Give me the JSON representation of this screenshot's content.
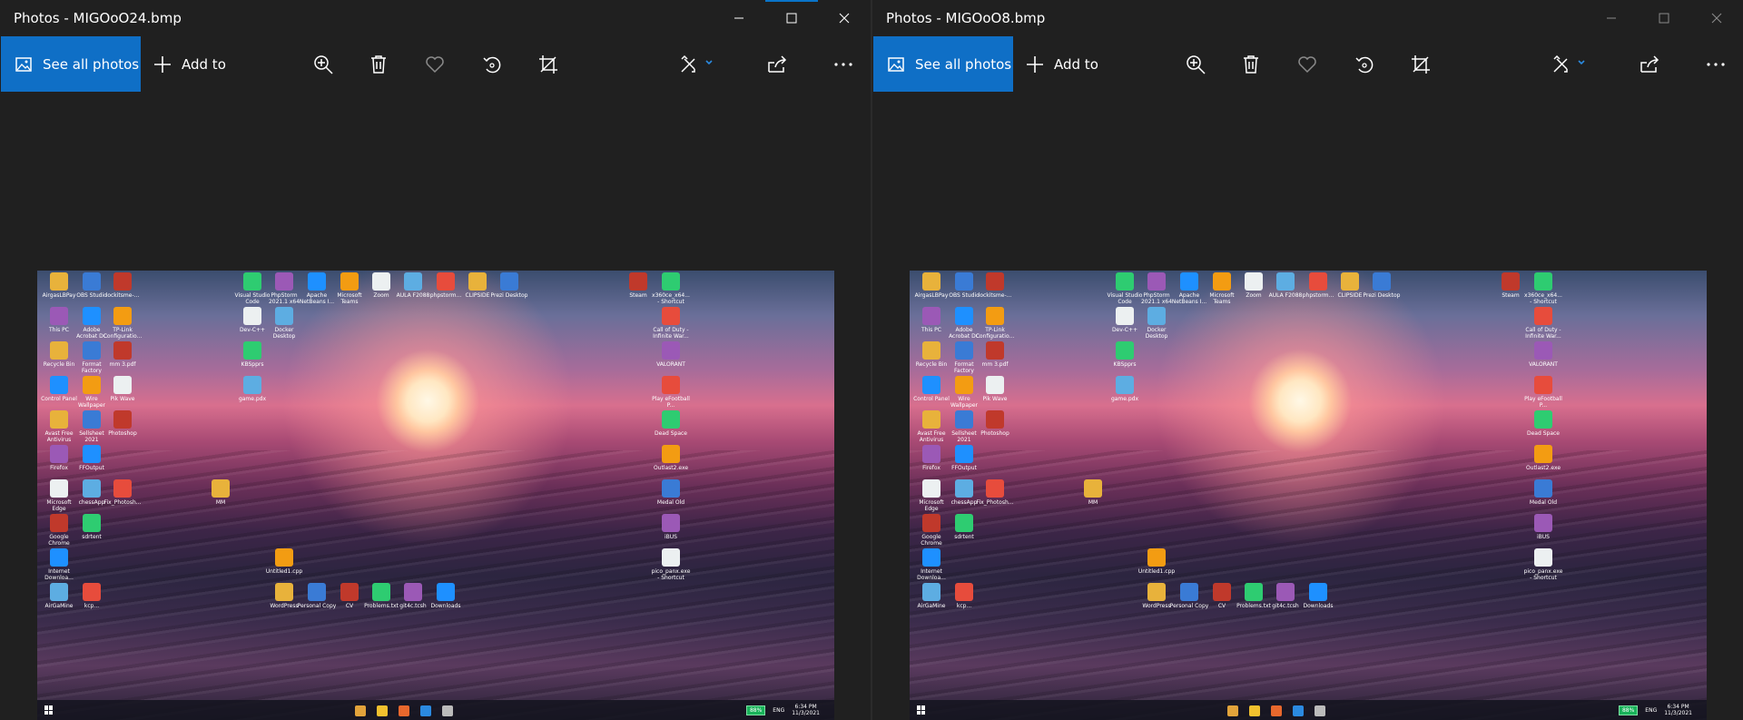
{
  "windows": [
    {
      "title": "Photos - MIGOoO24.bmp",
      "active": true,
      "toolbar": {
        "see_all": "See all photos",
        "add_to": "Add to",
        "icons": [
          "zoom-icon",
          "delete-icon",
          "favorite-icon",
          "rotate-icon",
          "crop-icon",
          "edit-icon",
          "share-icon",
          "more-icon"
        ]
      }
    },
    {
      "title": "Photos - MIGOoO8.bmp",
      "active": false,
      "toolbar": {
        "see_all": "See all photos",
        "add_to": "Add to",
        "icons": [
          "zoom-icon",
          "delete-icon",
          "favorite-icon",
          "rotate-icon",
          "crop-icon",
          "edit-icon",
          "share-icon",
          "more-icon"
        ]
      }
    }
  ],
  "desktop": {
    "icons": [
      "AirgasLBPay",
      "OBS Studio",
      "lockitsme-...",
      "Visual Studio Code",
      "PhpStorm 2021.1 x64",
      "Apache NetBeans I...",
      "Microsoft Teams",
      "Zoom",
      "AULA F2088",
      "phpstorm...",
      "CLIPSIDE",
      "Prezi Desktop",
      "Steam",
      "x360ce_x64... - Shortcut",
      "This PC",
      "Adobe Acrobat DC",
      "TP-Link Configuratio...",
      "Dev-C++",
      "Docker Desktop",
      "Call of Duty - Infinite War...",
      "Recycle Bin",
      "Format Factory",
      "mm 3.pdf",
      "KBSpprs",
      "VALORANT",
      "Control Panel",
      "Wire Wallpaper",
      "Pik Wave",
      "game.pdx",
      "Play eFootball P...",
      "Avast Free Antivirus",
      "Sellsheet 2021",
      "Photoshop",
      "Dead Space",
      "Firefox",
      "FFOutput",
      "Outlast2.exe",
      "Microsoft Edge",
      "chessApp",
      "Fix_Photosh...",
      "MM",
      "Medal Old",
      "Google Chrome",
      "sdrtent",
      "iBUS",
      "Internet Downloa...",
      "Untitled1.cpp",
      "pico_panx.exe - Shortcut",
      "AirGaMine",
      "kcp...",
      "WordPress",
      "Personal Copy",
      "CV",
      "Problems.txt",
      "git4c.tcsh",
      "Downloads"
    ],
    "tray": {
      "battery": "88%",
      "lang": "ENG",
      "time": "6:34 PM",
      "date": "11/3/2021"
    }
  },
  "colors": {
    "accent": "#0f6fc6",
    "background": "#202020"
  }
}
